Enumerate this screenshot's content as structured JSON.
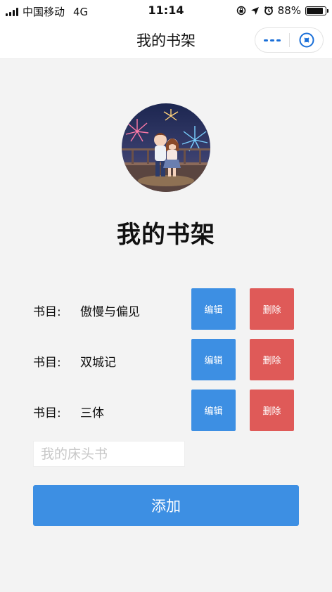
{
  "status_bar": {
    "carrier": "中国移动",
    "network": "4G",
    "time": "11:14",
    "battery_percent": "88%",
    "battery_level": 0.88,
    "icons": [
      "signal-icon",
      "lock-rotation-icon",
      "location-arrow-icon",
      "alarm-icon",
      "battery-icon"
    ]
  },
  "navbar": {
    "title": "我的书架",
    "capsule_icons": [
      "more-icon",
      "close-miniprogram-icon"
    ],
    "accent": "#1a6fd8"
  },
  "page": {
    "title": "我的书架",
    "avatar": "avatar-couple-fireworks-illustration"
  },
  "books": [
    {
      "label": "书目:",
      "name": "傲慢与偏见",
      "edit_label": "编辑",
      "delete_label": "删除"
    },
    {
      "label": "书目:",
      "name": "双城记",
      "edit_label": "编辑",
      "delete_label": "删除"
    },
    {
      "label": "书目:",
      "name": "三体",
      "edit_label": "编辑",
      "delete_label": "删除"
    }
  ],
  "add_form": {
    "placeholder": "我的床头书",
    "value": "",
    "add_label": "添加"
  },
  "colors": {
    "primary_button": "#3d8fe3",
    "danger_button": "#df5a58",
    "background": "#f3f3f3"
  }
}
